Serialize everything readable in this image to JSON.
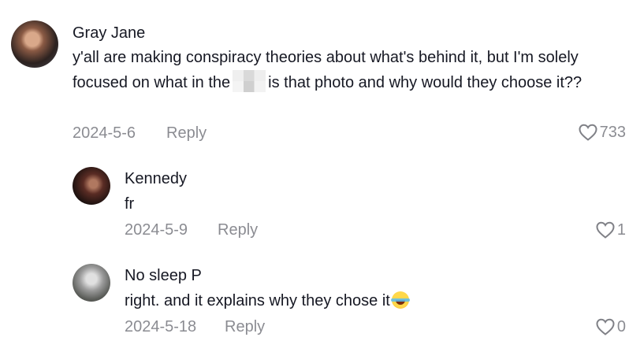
{
  "comments": [
    {
      "author": "Gray Jane",
      "text_part1": "y'all are making conspiracy theories about what's behind it, but I'm solely focused on what in the",
      "text_part2": "is that photo and why would they choose it??",
      "date": "2024-5-6",
      "reply_label": "Reply",
      "likes": "733"
    },
    {
      "author": "Kennedy",
      "text": "fr",
      "date": "2024-5-9",
      "reply_label": "Reply",
      "likes": "1"
    },
    {
      "author": "No sleep P",
      "text": "right. and it explains why they chose it",
      "date": "2024-5-18",
      "reply_label": "Reply",
      "likes": "0"
    }
  ],
  "icons": {
    "like": "heart-outline-icon",
    "emoji": "laughing-tears-emoji-icon",
    "censor": "pixelated-censor-block"
  },
  "colors": {
    "text": "#161823",
    "muted": "rgba(22,24,35,0.5)"
  }
}
